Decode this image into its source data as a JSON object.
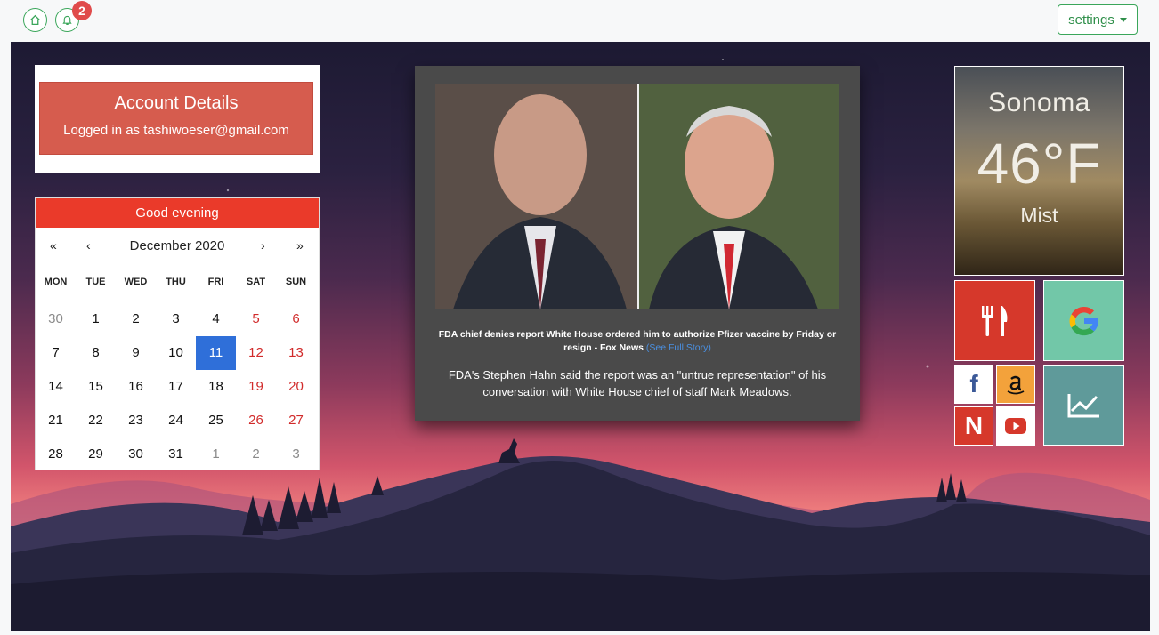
{
  "topbar": {
    "notifications_count": "2",
    "settings_label": "settings"
  },
  "account": {
    "title": "Account Details",
    "subtitle": "Logged in as tashiwoeser@gmail.com"
  },
  "calendar": {
    "greeting": "Good evening",
    "prev_year": "«",
    "prev_month": "‹",
    "month": "December 2020",
    "next_month": "›",
    "next_year": "»",
    "weekdays": [
      "MON",
      "TUE",
      "WED",
      "THU",
      "FRI",
      "SAT",
      "SUN"
    ],
    "weeks": [
      [
        "30",
        "1",
        "2",
        "3",
        "4",
        "5",
        "6"
      ],
      [
        "7",
        "8",
        "9",
        "10",
        "11",
        "12",
        "13"
      ],
      [
        "14",
        "15",
        "16",
        "17",
        "18",
        "19",
        "20"
      ],
      [
        "21",
        "22",
        "23",
        "24",
        "25",
        "26",
        "27"
      ],
      [
        "28",
        "29",
        "30",
        "31",
        "1",
        "2",
        "3"
      ]
    ],
    "today": "11"
  },
  "news": {
    "headline": "FDA chief denies report White House ordered him to authorize Pfizer vaccine by Friday or resign - Fox News",
    "link_label": "(See Full Story)",
    "summary": "FDA's Stephen Hahn said the report was an \"untrue representation\" of his conversation with White House chief of staff Mark Meadows."
  },
  "weather": {
    "city": "Sonoma",
    "temperature": "46°F",
    "condition": "Mist"
  },
  "tiles": {
    "facebook_letter": "f",
    "netflix_letter": "N"
  },
  "colors": {
    "accent_green": "#3aa65a",
    "calendar_red": "#ea3a2a",
    "account_red": "#d65c4e",
    "today_blue": "#2f6fd9",
    "link_blue": "#4a90e2"
  }
}
